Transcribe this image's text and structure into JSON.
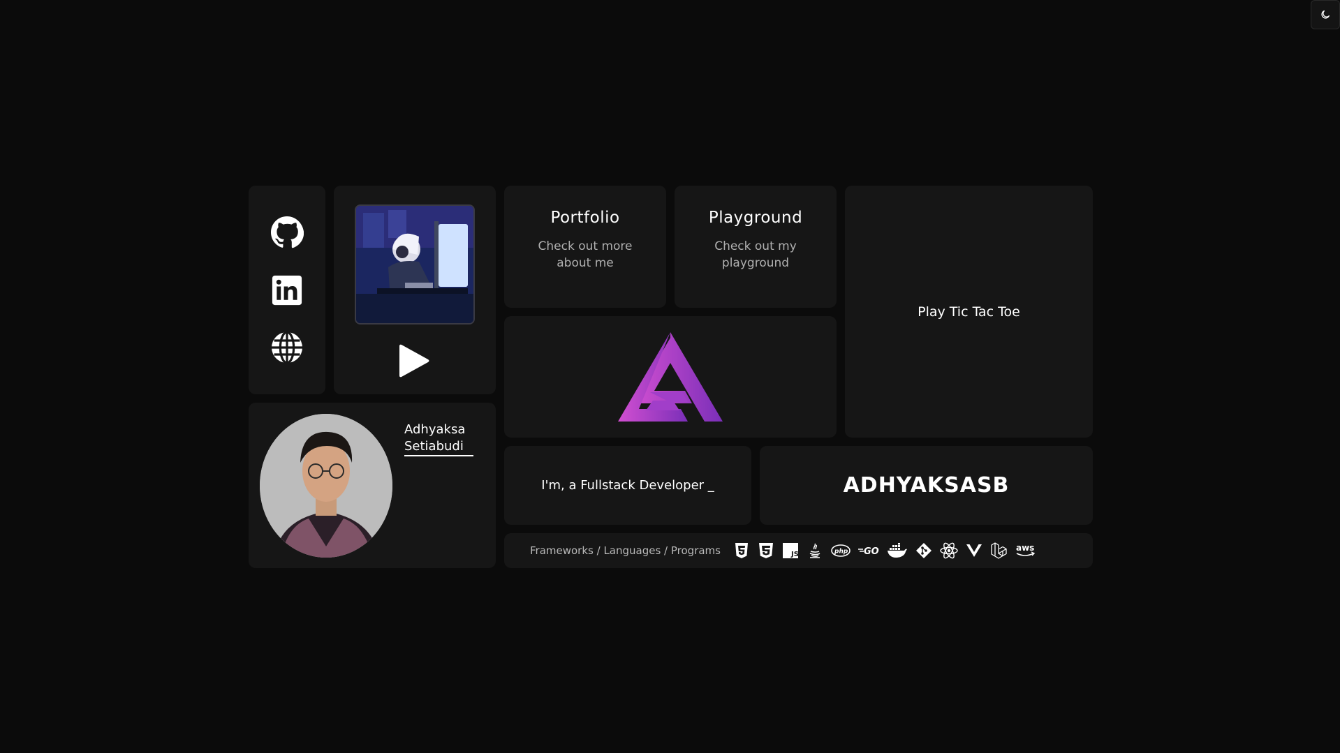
{
  "theme_toggle": {
    "icon": "moon-icon"
  },
  "socials": [
    {
      "name": "GitHub",
      "icon": "github-icon"
    },
    {
      "name": "LinkedIn",
      "icon": "linkedin-icon"
    },
    {
      "name": "Website",
      "icon": "globe-icon"
    }
  ],
  "player": {
    "album_icon": "album-art",
    "play_icon": "play-icon"
  },
  "portfolio": {
    "title": "Portfolio",
    "subtitle": "Check out more about me"
  },
  "playground": {
    "title": "Playground",
    "subtitle": "Check out my playground"
  },
  "tictactoe": {
    "label": "Play Tic Tac Toe"
  },
  "logo": {
    "icon": "brand-logo",
    "colors": [
      "#c44fd6",
      "#7b2fbf"
    ]
  },
  "profile": {
    "first_name": "Adhyaksa",
    "last_name": "Setiabudi"
  },
  "role": {
    "text": "I'm, a Fullstack Developer _"
  },
  "brand": {
    "text": "ADHYAKSASB"
  },
  "tech": {
    "label": "Frameworks / Languages / Programs",
    "icons": [
      "html5-icon",
      "css3-icon",
      "javascript-icon",
      "java-icon",
      "php-icon",
      "go-icon",
      "docker-icon",
      "git-icon",
      "react-icon",
      "vue-icon",
      "laravel-icon",
      "aws-icon"
    ],
    "php_text": "php",
    "go_text": "GO",
    "js_text": "JS",
    "aws_text": "aws"
  }
}
